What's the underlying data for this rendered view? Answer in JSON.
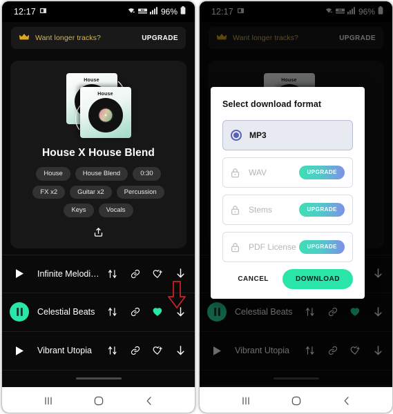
{
  "status_bar": {
    "time": "12:17",
    "battery": "96%",
    "icons": [
      "screenshot-icon",
      "wifi-icon",
      "hd-icon",
      "signal-icon",
      "battery-icon"
    ]
  },
  "banner": {
    "icon": "crown-icon",
    "text": "Want longer tracks?",
    "cta": "UPGRADE"
  },
  "card": {
    "artwork_label": "House",
    "title": "House X House Blend",
    "chips": [
      "House",
      "House Blend",
      "0:30",
      "FX x2",
      "Guitar x2",
      "Percussion",
      "Keys",
      "Vocals"
    ],
    "share_icon": "share-icon"
  },
  "tracks": [
    {
      "name": "Infinite Melodi…",
      "state": "paused",
      "liked": false
    },
    {
      "name": "Celestial Beats",
      "state": "playing",
      "liked": true
    },
    {
      "name": "Vibrant Utopia",
      "state": "paused",
      "liked": false
    }
  ],
  "track_icons": [
    "mixer-icon",
    "link-icon",
    "heart-plus-icon",
    "download-icon"
  ],
  "dialog": {
    "title": "Select download format",
    "options": [
      {
        "label": "MP3",
        "locked": false,
        "selected": true,
        "pill": ""
      },
      {
        "label": "WAV",
        "locked": true,
        "selected": false,
        "pill": "UPGRADE"
      },
      {
        "label": "Stems",
        "locked": true,
        "selected": false,
        "pill": "UPGRADE"
      },
      {
        "label": "PDF License",
        "locked": true,
        "selected": false,
        "pill": "UPGRADE"
      }
    ],
    "cancel_label": "CANCEL",
    "download_label": "DOWNLOAD"
  },
  "nav_bar": {
    "recents": "recents-icon",
    "home": "home-icon",
    "back": "back-icon"
  },
  "colors": {
    "accent_green": "#2ae5a8",
    "banner_gold": "#d9b84a",
    "radio_blue": "#5562b8",
    "annotation_red": "#cc2222",
    "screen_bg": "#0a0a0a"
  },
  "annotations": [
    {
      "name": "arrow-to-track-download",
      "color": "#cc2222"
    },
    {
      "name": "arrow-to-download-button",
      "color": "#cc2222"
    }
  ]
}
